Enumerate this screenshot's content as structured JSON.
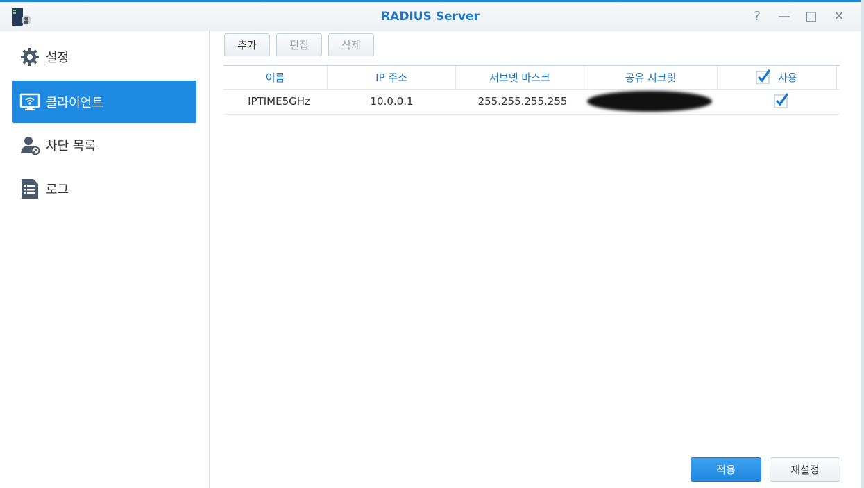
{
  "window": {
    "title": "RADIUS Server",
    "controls": {
      "help": "?",
      "minimize": "—",
      "maximize": "□",
      "close": "✕"
    }
  },
  "sidebar": {
    "items": [
      {
        "label": "설정",
        "icon": "gear-icon",
        "active": false
      },
      {
        "label": "클라이언트",
        "icon": "monitor-wifi-icon",
        "active": true
      },
      {
        "label": "차단 목록",
        "icon": "user-block-icon",
        "active": false
      },
      {
        "label": "로그",
        "icon": "list-icon",
        "active": false
      }
    ]
  },
  "toolbar": {
    "add_label": "추가",
    "edit_label": "편집",
    "delete_label": "삭제"
  },
  "table": {
    "columns": [
      "이름",
      "IP 주소",
      "서브넷 마스크",
      "공유 시크릿",
      "사용"
    ],
    "rows": [
      {
        "name": "IPTIME5GHz",
        "ip": "10.0.0.1",
        "subnet": "255.255.255.255",
        "secret": "",
        "enabled": true
      }
    ]
  },
  "footer": {
    "apply_label": "적용",
    "reset_label": "재설정"
  },
  "colors": {
    "accent": "#1f8ae2",
    "title": "#1a76c9"
  }
}
